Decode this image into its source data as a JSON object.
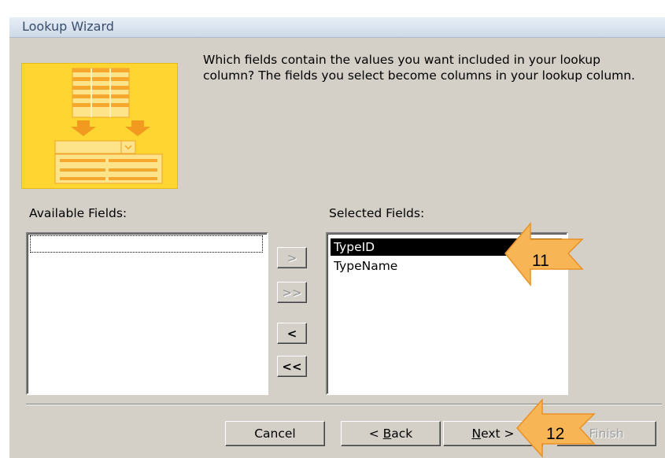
{
  "window": {
    "title": "Lookup Wizard"
  },
  "description": "Which fields contain the values you want included in your lookup column? The fields you select become columns in your lookup column.",
  "available_fields": {
    "label": "Available Fields:",
    "items": []
  },
  "selected_fields": {
    "label": "Selected Fields:",
    "items": [
      "TypeID",
      "TypeName"
    ],
    "selected_index": 0
  },
  "move_buttons": {
    "add_one": ">",
    "add_all": ">>",
    "remove_one": "<",
    "remove_all": "<<"
  },
  "footer": {
    "cancel": "Cancel",
    "back_prefix": "< ",
    "back_mnemonic": "B",
    "back_rest": "ack",
    "next_mnemonic": "N",
    "next_rest": "ext >",
    "finish": "Finish"
  },
  "callouts": [
    {
      "number": "11"
    },
    {
      "number": "12"
    }
  ],
  "colors": {
    "callout_fill": "#f7b555",
    "callout_stroke": "#e89226",
    "graphic_bg": "#fed531"
  }
}
